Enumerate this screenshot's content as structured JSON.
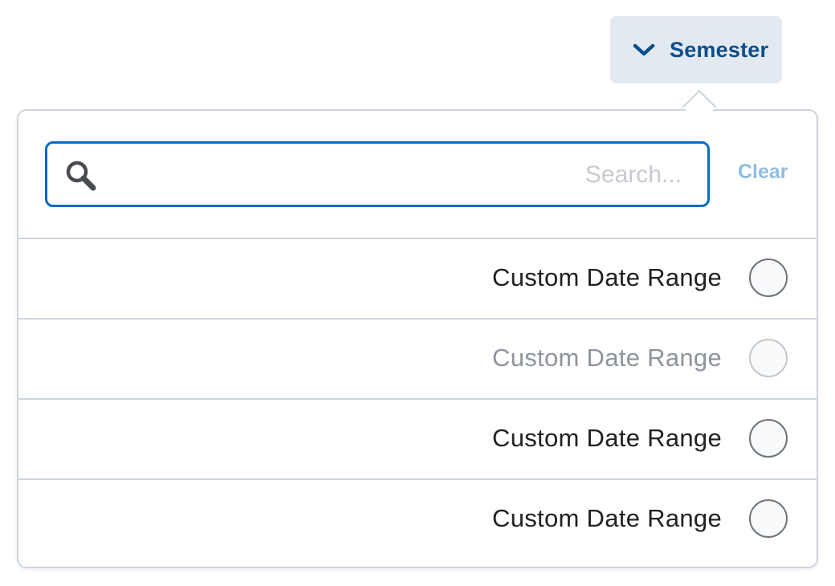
{
  "filter": {
    "label": "Semester",
    "icon": "chevron-down-icon",
    "accent_color": "#0b4e8a",
    "background_color": "#e3e9f1"
  },
  "search": {
    "value": "",
    "placeholder": "...Search",
    "icon": "search-icon",
    "border_color": "#0a6bc2"
  },
  "clear": {
    "label": "Clear",
    "color": "#8fbde3"
  },
  "options": [
    {
      "label": "Custom Date Range",
      "disabled": false,
      "selected": false
    },
    {
      "label": "Custom Date Range",
      "disabled": true,
      "selected": false
    },
    {
      "label": "Custom Date Range",
      "disabled": false,
      "selected": false
    },
    {
      "label": "Custom Date Range",
      "disabled": false,
      "selected": false
    }
  ]
}
